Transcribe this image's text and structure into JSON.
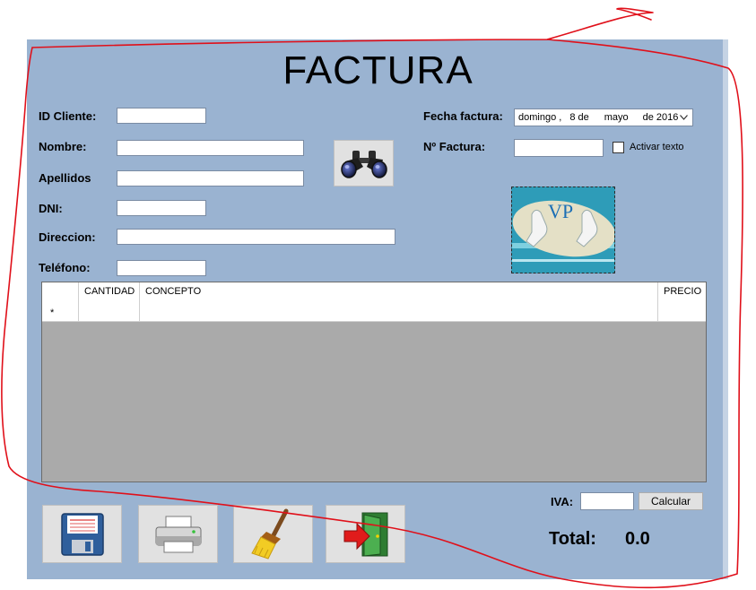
{
  "form": {
    "title": "FACTURA",
    "labels": {
      "id_cliente": "ID Cliente:",
      "nombre": "Nombre:",
      "apellidos": "Apellidos",
      "dni": "DNI:",
      "direccion": "Direccion:",
      "telefono": "Teléfono:",
      "fecha_factura": "Fecha factura:",
      "n_factura": "Nº Factura:",
      "iva": "IVA:",
      "total": "Total:"
    },
    "fields": {
      "id_cliente": "",
      "nombre": "",
      "apellidos": "",
      "dni": "",
      "direccion": "",
      "telefono": "",
      "n_factura": "",
      "iva": ""
    },
    "date": {
      "weekday": "domingo ,",
      "day": "8 de",
      "month": "mayo",
      "year": "de 2016"
    },
    "activar_texto_label": "Activar texto",
    "activar_texto_checked": false,
    "calcular_label": "Calcular",
    "total_value": "0.0",
    "logo_text": "VP",
    "grid": {
      "columns": [
        "",
        "CANTIDAD",
        "CONCEPTO",
        "PRECIO"
      ],
      "new_row_marker": "*"
    },
    "icons": {
      "search": "binoculars-icon",
      "save": "floppy-disk-icon",
      "print": "printer-icon",
      "clear": "broom-icon",
      "exit": "exit-door-icon",
      "date_dropdown": "chevron-down-icon"
    },
    "colors": {
      "panel": "#9ab3d1",
      "grid_background": "#aaaaaa",
      "annotation": "#e0101a"
    }
  }
}
